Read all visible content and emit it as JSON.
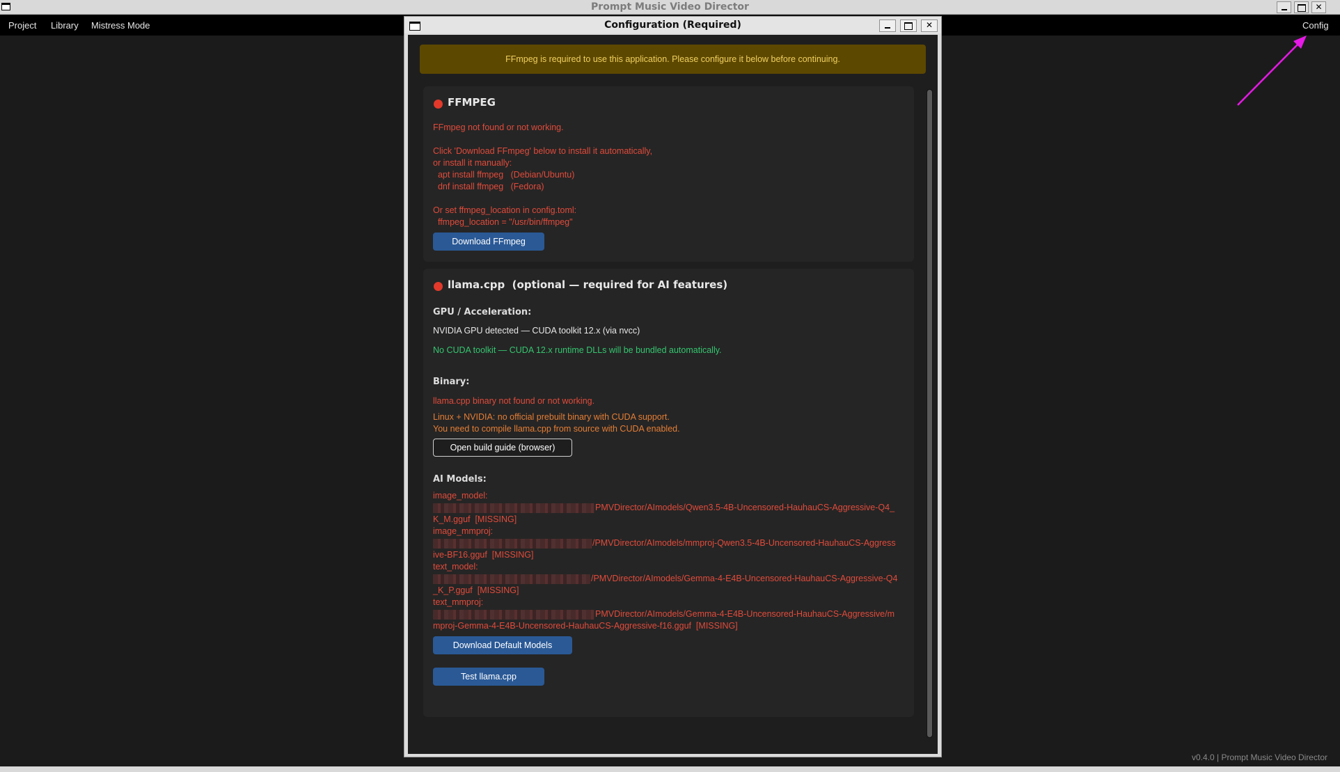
{
  "window": {
    "title": "Prompt Music Video Director"
  },
  "menubar": {
    "items": [
      "Project",
      "Library",
      "Mistress Mode"
    ],
    "config_label": "Config"
  },
  "footer": {
    "version_text": "v0.4.0 | Prompt Music Video Director"
  },
  "annotation": {
    "arrow_color": "#e619e6"
  },
  "dialog": {
    "title": "Configuration (Required)",
    "banner": "FFmpeg is required to use this application. Please configure it below before continuing.",
    "ffmpeg": {
      "title": "FFMPEG",
      "status": "FFmpeg not found or not working.",
      "help_lines": [
        "Click 'Download FFmpeg' below to install it automatically,",
        "or install it manually:",
        "  apt install ffmpeg   (Debian/Ubuntu)",
        "  dnf install ffmpeg   (Fedora)",
        "Or set ffmpeg_location in config.toml:",
        "  ffmpeg_location = \"/usr/bin/ffmpeg\""
      ],
      "download_button": "Download FFmpeg"
    },
    "llama": {
      "title": "llama.cpp  (optional — required for AI features)",
      "gpu_heading": "GPU / Acceleration:",
      "gpu_detected": "NVIDIA GPU detected — CUDA toolkit 12.x (via nvcc)",
      "gpu_note": "No CUDA toolkit — CUDA 12.x runtime DLLs will be bundled automatically.",
      "binary_heading": "Binary:",
      "binary_status": "llama.cpp binary not found or not working.",
      "binary_note_1": "Linux + NVIDIA: no official prebuilt binary with CUDA support.",
      "binary_note_2": "You need to compile llama.cpp from source with CUDA enabled.",
      "build_guide_button": "Open build guide (browser)",
      "models_heading": "AI Models:",
      "models": [
        {
          "label": "image_model:",
          "path_1": "PMVDirector/AImodels/Qwen3.5-4B-Uncensored-HauhauCS-Aggressive-Q4_",
          "path_2": "K_M.gguf  [MISSING]"
        },
        {
          "label": "image_mmproj:",
          "path_1": "/PMVDirector/AImodels/mmproj-Qwen3.5-4B-Uncensored-HauhauCS-Aggress",
          "path_2": "ive-BF16.gguf  [MISSING]"
        },
        {
          "label": "text_model:",
          "path_1": "/PMVDirector/AImodels/Gemma-4-E4B-Uncensored-HauhauCS-Aggressive-Q4",
          "path_2": "_K_P.gguf  [MISSING]"
        },
        {
          "label": "text_mmproj:",
          "path_1": "PMVDirector/AImodels/Gemma-4-E4B-Uncensored-HauhauCS-Aggressive/m",
          "path_2": "mproj-Gemma-4-E4B-Uncensored-HauhauCS-Aggressive-f16.gguf  [MISSING]"
        }
      ],
      "download_models_button": "Download Default Models",
      "test_button": "Test llama.cpp"
    }
  }
}
